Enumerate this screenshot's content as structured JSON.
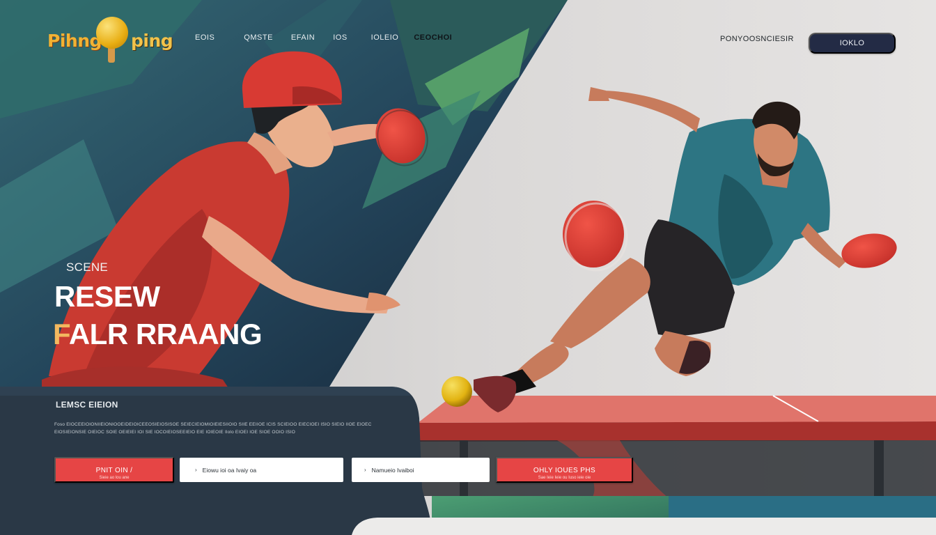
{
  "header": {
    "logo": {
      "word_left": "Pihng",
      "word_right": "ping"
    },
    "nav": [
      "EOIS",
      "QMSTE",
      "EFAIN",
      "IOS",
      "IOLEIO",
      "CEOCHOI"
    ],
    "link": "PONYOOSNCIESIR",
    "button": "IOKLO"
  },
  "hero": {
    "eyebrow": "SCENE",
    "headline_line1": "RESEW",
    "headline_line2_accent": "F",
    "headline_line2_rest": "ALR RRAANG"
  },
  "panel": {
    "title": "LEMSC EIEION",
    "text": "Foso EIOCEEIOIONIIEIONIOOEIDEIOICEEOSIEIOSISOE SEIECIEIOMIOIEIESIIOIO SIIE EEIIOE ICIS SCIEIOO EIECIOEI ISIO SIEIO IIOE EIOEC EIOSIEIONSIE OIEIOC SOIE OEIEIEI IOI SIE IOCOIEIOSEEIEIO EIE IOIEOIE Ilolo EIOEI IOE SIOE OOIO ISIO"
  },
  "actions": {
    "primary": {
      "label": "PNIT OIN /",
      "sub": "Sieie ao lou ane"
    },
    "field_one": {
      "value": "Eiowu ioi oa Ivaiy oa"
    },
    "field_two": {
      "value": "Namueio Ivaiboi"
    },
    "secondary": {
      "label": "OHLY IOUES PHS",
      "sub": "Sae Ieie Ieie ou Iuso ieie oie"
    }
  },
  "colors": {
    "accent_red": "#e64545",
    "header_button": "#232b45",
    "logo_yellow": "#f2b233",
    "panel_dark": "#2a3846"
  },
  "icons": {
    "field_one": "chevron-right-icon",
    "field_two": "chevron-right-icon"
  }
}
